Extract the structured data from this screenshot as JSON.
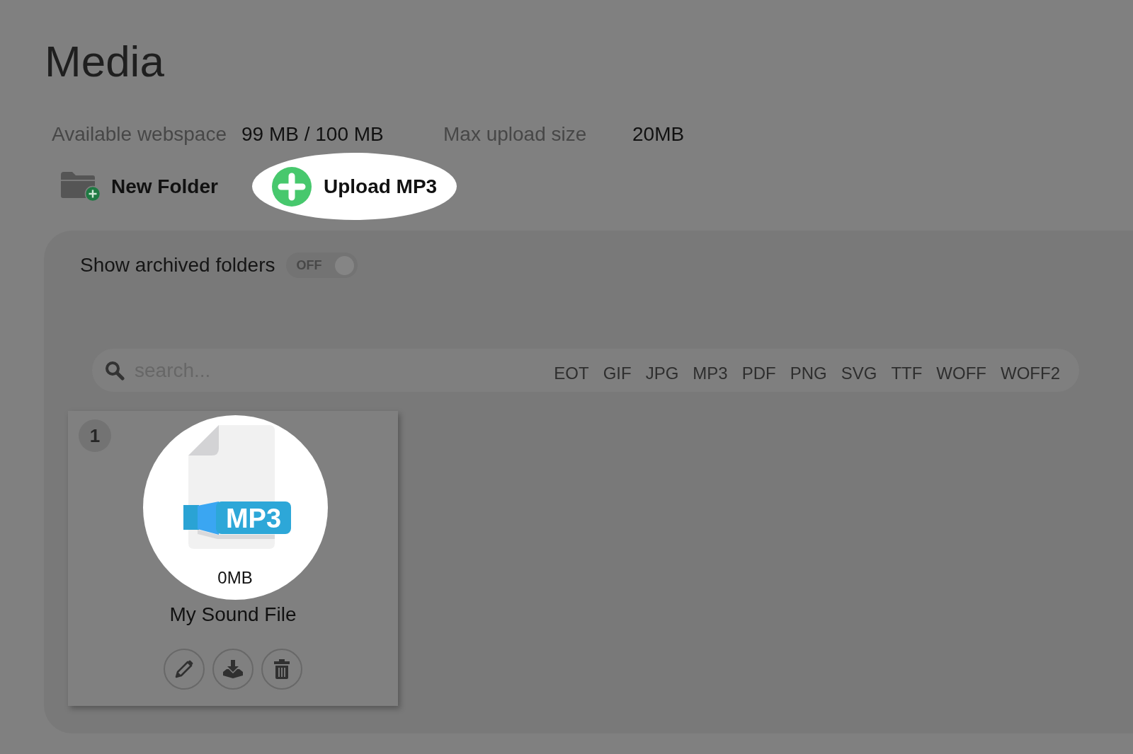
{
  "page": {
    "title": "Media"
  },
  "stats": [
    {
      "label": "Available webspace",
      "value": "99 MB / 100 MB"
    },
    {
      "label": "Max upload size",
      "value": "20MB"
    }
  ],
  "actions": [
    {
      "kind": "folder",
      "label": "New Folder",
      "highlighted": false
    },
    {
      "kind": "upload",
      "label": "Upload MP3",
      "highlighted": true
    }
  ],
  "archive_toggle": {
    "label": "Show archived folders",
    "state_text": "OFF",
    "on": false
  },
  "search": {
    "placeholder": "search..."
  },
  "filters": [
    "EOT",
    "GIF",
    "JPG",
    "MP3",
    "PDF",
    "PNG",
    "SVG",
    "TTF",
    "WOFF",
    "WOFF2"
  ],
  "files": [
    {
      "number": "1",
      "type_label": "MP3",
      "size": "0MB",
      "name": "My Sound File",
      "highlighted": true
    }
  ]
}
